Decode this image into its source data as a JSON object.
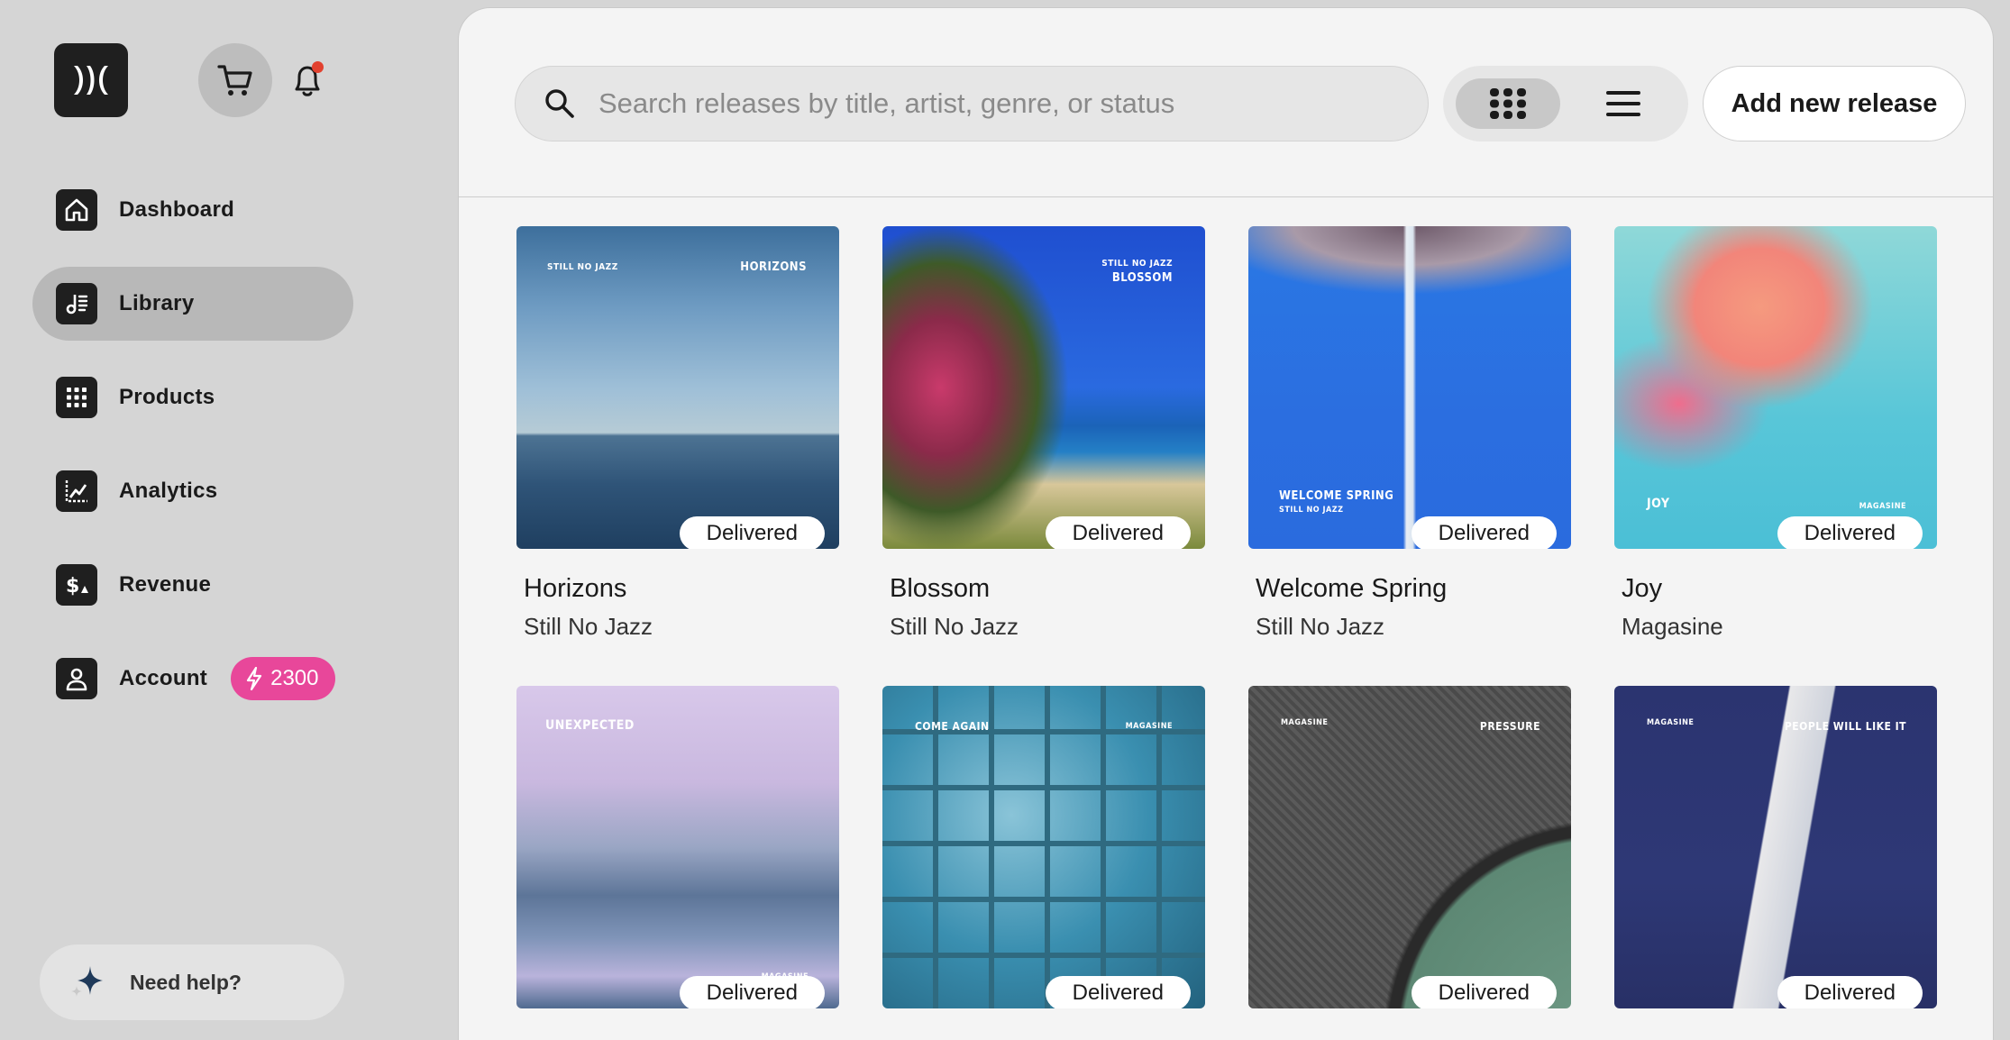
{
  "sidebar": {
    "nav": [
      {
        "label": "Dashboard",
        "icon": "home-icon"
      },
      {
        "label": "Library",
        "icon": "music-library-icon",
        "active": true
      },
      {
        "label": "Products",
        "icon": "grid-icon"
      },
      {
        "label": "Analytics",
        "icon": "chart-icon"
      },
      {
        "label": "Revenue",
        "icon": "dollar-icon"
      },
      {
        "label": "Account",
        "icon": "user-icon"
      }
    ],
    "credits": "2300",
    "help_label": "Need help?"
  },
  "header": {
    "search_placeholder": "Search releases by title, artist, genre, or status",
    "add_label": "Add new release"
  },
  "releases": [
    {
      "title": "Horizons",
      "artist": "Still No Jazz",
      "status": "Delivered"
    },
    {
      "title": "Blossom",
      "artist": "Still No Jazz",
      "status": "Delivered"
    },
    {
      "title": "Welcome Spring",
      "artist": "Still No Jazz",
      "status": "Delivered"
    },
    {
      "title": "Joy",
      "artist": "Magasine",
      "status": "Delivered"
    },
    {
      "title": "",
      "artist": "",
      "status": "Delivered"
    },
    {
      "title": "",
      "artist": "",
      "status": "Delivered"
    },
    {
      "title": "",
      "artist": "",
      "status": "Delivered"
    },
    {
      "title": "",
      "artist": "",
      "status": "Delivered"
    }
  ],
  "cover_text": {
    "c0": {
      "a": "STILL NO JAZZ",
      "b": "HORIZONS"
    },
    "c1": {
      "a": "STILL NO JAZZ",
      "b": "BLOSSOM"
    },
    "c2": {
      "a": "WELCOME SPRING",
      "b": "STILL NO JAZZ"
    },
    "c3": {
      "a": "JOY",
      "b": "MAGASINE"
    },
    "c4": {
      "a": "UNEXPECTED",
      "b": "MAGASINE"
    },
    "c5": {
      "a": "COME AGAIN",
      "b": "MAGASINE"
    },
    "c6": {
      "a": "MAGASINE",
      "b": "PRESSURE"
    },
    "c7": {
      "a": "MAGASINE",
      "b": "PEOPLE WILL LIKE IT"
    }
  },
  "colors": {
    "accent_badge": "#e8479a",
    "notification_dot": "#e2412f"
  }
}
